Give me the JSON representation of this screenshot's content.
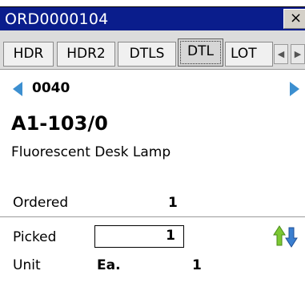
{
  "window": {
    "title": "ORD0000104",
    "close_label": "×"
  },
  "tabs": [
    {
      "label": "HDR",
      "active": false
    },
    {
      "label": "HDR2",
      "active": false
    },
    {
      "label": "DTLS",
      "active": false
    },
    {
      "label": "DTL",
      "active": true
    },
    {
      "label": "LOT",
      "active": false
    }
  ],
  "detail": {
    "line_number": "0040",
    "item_code": "A1-103/0",
    "description": "Fluorescent Desk Lamp"
  },
  "fields": {
    "ordered_label": "Ordered",
    "ordered_value": "1",
    "picked_label": "Picked",
    "picked_value": "1",
    "unit_label": "Unit",
    "unit_value": "Ea.",
    "unit_qty": "1"
  },
  "icons": {
    "prev": "arrow-left-icon",
    "next": "arrow-right-icon",
    "sort": "sort-up-down-icon"
  },
  "colors": {
    "titlebar": "#0a1d8c",
    "nav_arrow": "#3c8fd0",
    "sort_up": "#7cc832",
    "sort_down": "#3a7fd0"
  }
}
